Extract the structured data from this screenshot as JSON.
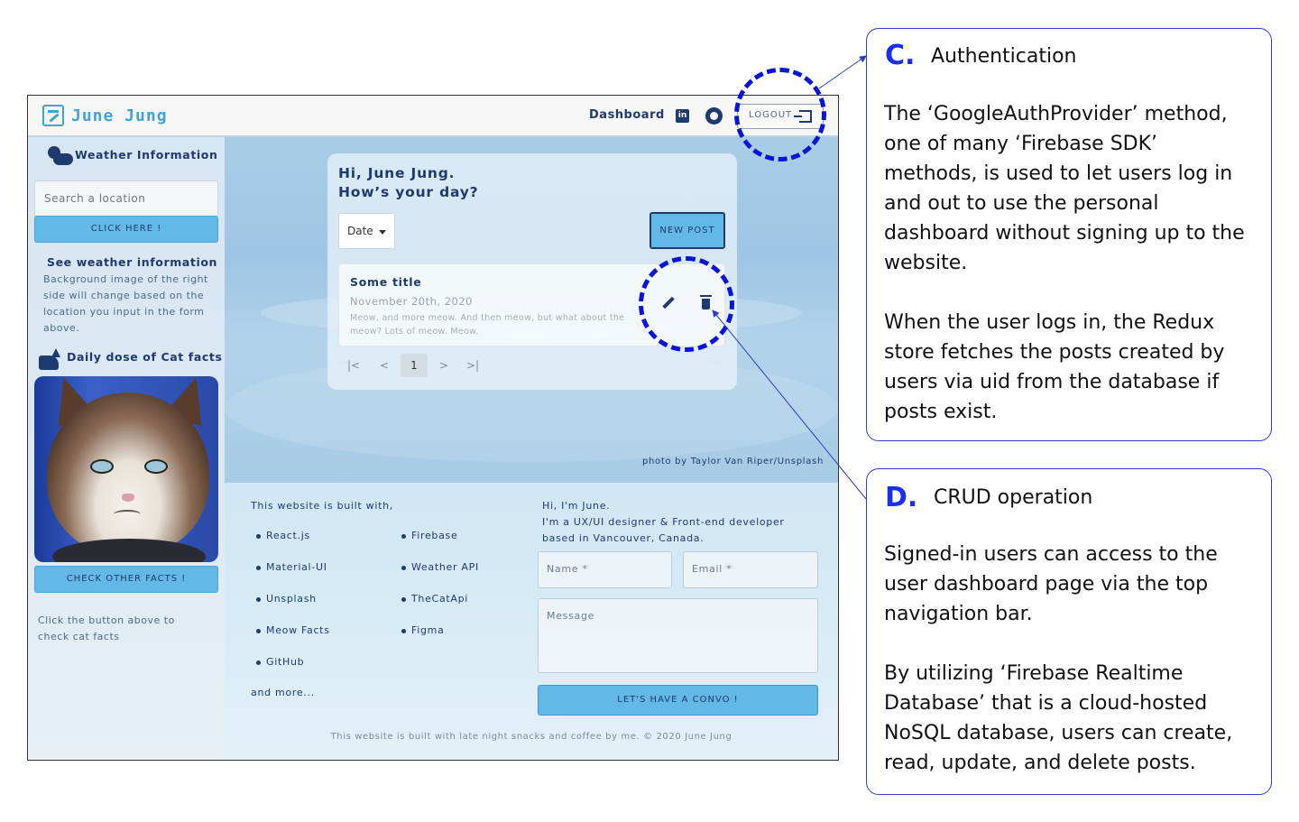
{
  "nav": {
    "brand": "June Jung",
    "dashboard_link": "Dashboard",
    "linkedin_icon": "linkedin-icon",
    "github_icon": "github-icon",
    "logout_label": "LOGOUT"
  },
  "sidebar": {
    "weather_title": "Weather Information",
    "search_placeholder": "Search a location",
    "search_button": "CLICK HERE !",
    "weather_heading": "See weather information",
    "weather_desc": "Background image of the right side will change based on the location you input in the form above.",
    "cat_title": "Daily dose of Cat facts",
    "cat_button": "CHECK OTHER FACTS !",
    "cat_hint": "Click the button above to check cat facts"
  },
  "main": {
    "greeting_line1": "Hi, June Jung.",
    "greeting_line2": "How’s your day?",
    "sort_value": "Date",
    "new_post_button": "NEW POST",
    "post": {
      "title": "Some title",
      "date": "November 20th, 2020",
      "body": "Meow, and more meow. And then meow, but what about the meow? Lots of meow. Meow."
    },
    "pagination": {
      "first": "|<",
      "prev": "<",
      "current": "1",
      "next": ">",
      "last": ">|"
    },
    "photo_credit": "photo by Taylor Van Riper/Unsplash"
  },
  "footer": {
    "built_with_title": "This website is built with,",
    "tools_left": [
      "React.js",
      "Material-UI",
      "Unsplash",
      "Meow Facts",
      "GitHub"
    ],
    "tools_right": [
      "Firebase",
      "Weather API",
      "TheCatApi",
      "Figma"
    ],
    "and_more": "and more...",
    "about_line1": "Hi, I'm June.",
    "about_line2": "I'm a UX/UI designer & Front-end developer",
    "about_line3": "based in Vancouver, Canada.",
    "name_placeholder": "Name *",
    "email_placeholder": "Email *",
    "message_placeholder": "Message",
    "submit_button": "LET'S HAVE A CONVO !",
    "copyright": "This website is built with late night snacks and coffee by me. © 2020 June Jung"
  },
  "annotations": {
    "c": {
      "letter": "C.",
      "title": "Authentication",
      "para1": "The ‘GoogleAuthProvider’ method, one of many ‘Firebase SDK’ methods, is used to let users log in and out to use the personal dashboard without signing up to the website.",
      "para2": "When the user logs in, the Redux store fetches the posts created by users via uid from the database if posts exist."
    },
    "d": {
      "letter": "D.",
      "title": "CRUD operation",
      "para1": "Signed-in users can access to the user dashboard page via the top navigation bar.",
      "para2": "By utilizing ‘Firebase Realtime Database’ that is a cloud-hosted NoSQL database, users can create, read, update, and delete posts."
    }
  },
  "colors": {
    "accent": "#63b9e6",
    "navy": "#1e3a6e",
    "callout": "#0a14d8"
  }
}
